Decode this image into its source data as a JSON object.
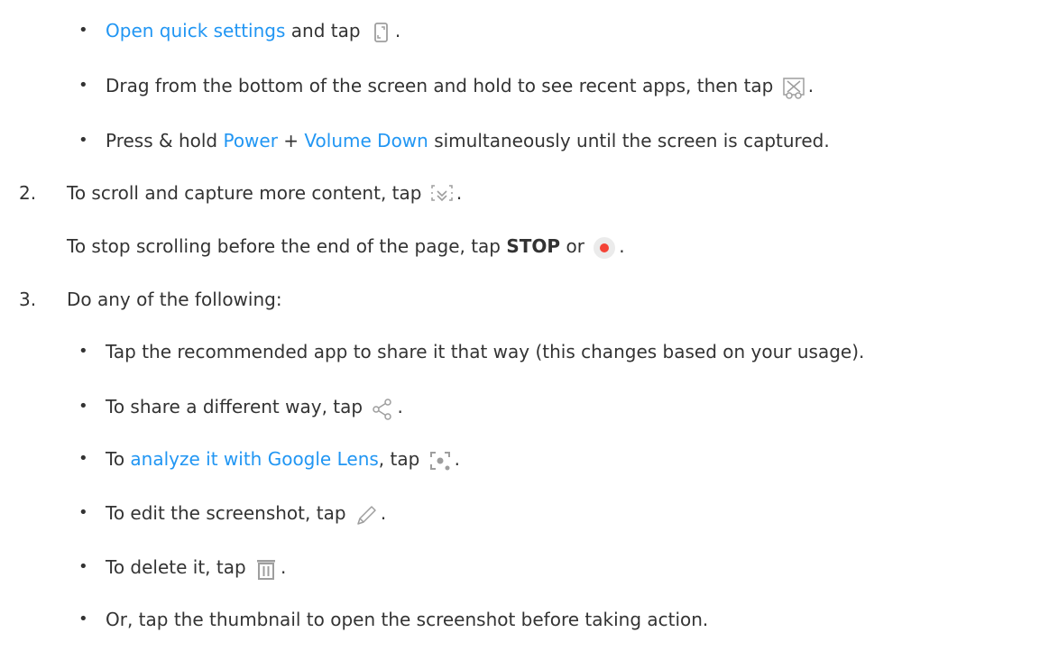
{
  "bullets": {
    "b1": {
      "link": "Open quick settings",
      "after": " and tap ",
      "icon": "screenshot-tile-icon",
      "end": "."
    },
    "b2": {
      "text": "Drag from the bottom of the screen and hold to see recent apps, then tap ",
      "icon": "screenshot-crop-icon",
      "end": "."
    },
    "b3": {
      "before": "Press & hold ",
      "link1": "Power",
      "mid": " + ",
      "link2": "Volume Down",
      "after": " simultaneously until the screen is captured."
    }
  },
  "steps": {
    "s2": {
      "number": "2.",
      "text": "To scroll and capture more content, tap ",
      "icon": "capture-more-icon",
      "end": "."
    },
    "s2_note": {
      "before": "To stop scrolling before the end of the page, tap ",
      "bold": "STOP",
      "mid": " or ",
      "icon": "record-stop-icon",
      "end": "."
    },
    "s3": {
      "number": "3.",
      "text": "Do any of the following:"
    }
  },
  "sub_bullets": {
    "c1": {
      "text": "Tap the recommended app to share it that way (this changes based on your usage)."
    },
    "c2": {
      "text": "To share a different way, tap ",
      "icon": "share-icon",
      "end": "."
    },
    "c3": {
      "before": "To ",
      "link": "analyze it with Google Lens",
      "after": ", tap ",
      "icon": "lens-icon",
      "end": "."
    },
    "c4": {
      "text": "To edit the screenshot, tap ",
      "icon": "edit-pencil-icon",
      "end": "."
    },
    "c5": {
      "text": "To delete it, tap ",
      "icon": "trash-icon",
      "end": "."
    },
    "c6": {
      "text": "Or, tap the thumbnail to open the screenshot before taking action."
    }
  },
  "bullet_glyph": "•",
  "colors": {
    "text": "#333333",
    "link": "#2196f3",
    "icon": "#9e9e9e",
    "record": "#f44336"
  }
}
